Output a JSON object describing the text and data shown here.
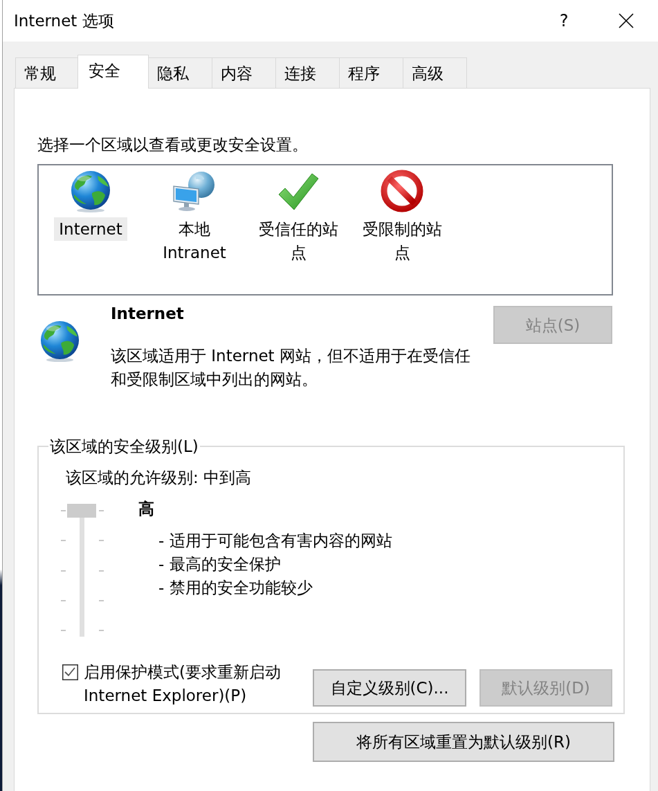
{
  "window": {
    "title": "Internet 选项",
    "help": "?"
  },
  "tabs": [
    {
      "label": "常规",
      "selected": false
    },
    {
      "label": "安全",
      "selected": true
    },
    {
      "label": "隐私",
      "selected": false
    },
    {
      "label": "内容",
      "selected": false
    },
    {
      "label": "连接",
      "selected": false
    },
    {
      "label": "程序",
      "selected": false
    },
    {
      "label": "高级",
      "selected": false
    }
  ],
  "security_tab": {
    "instruction": "选择一个区域以查看或更改安全设置。",
    "zones": [
      {
        "kind": "globe",
        "label": "Internet",
        "selected": true
      },
      {
        "kind": "intranet",
        "label": "本地 Intranet",
        "selected": false
      },
      {
        "kind": "trusted",
        "label": "受信任的站点",
        "selected": false
      },
      {
        "kind": "restricted",
        "label": "受限制的站点",
        "selected": false
      }
    ],
    "zone_info": {
      "kind": "globe",
      "name": "Internet",
      "description": "该区域适用于 Internet 网站，但不适用于在受信任和受限制区域中列出的网站。"
    },
    "sites_button": {
      "label": "站点(S)",
      "disabled": true
    },
    "security_level": {
      "title": "该区域的安全级别(L)",
      "allowed": "该区域的允许级别: 中到高",
      "slider": {
        "level": 1
      },
      "level_name": "高",
      "points": [
        "- 适用于可能包含有害内容的网站",
        "- 最高的安全保护",
        "- 禁用的安全功能较少"
      ],
      "protected_mode": {
        "label": "启用保护模式(要求重新启动 Internet Explorer)(P)",
        "checked": true
      },
      "buttons": [
        {
          "label": "自定义级别(C)...",
          "disabled": false
        },
        {
          "label": "默认级别(D)",
          "disabled": true
        }
      ]
    },
    "reset_button": {
      "label": "将所有区域重置为默认级别(R)",
      "disabled": false
    }
  }
}
